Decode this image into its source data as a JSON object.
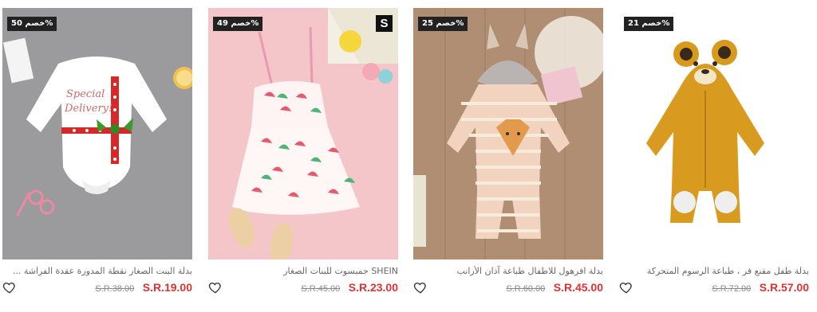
{
  "colors": {
    "sale": "#e03131",
    "badge_bg": "#222222",
    "old_price": "#888888"
  },
  "products": [
    {
      "badge": "خصم 50%",
      "title": "بدلة البنت الصغار نقطة المدورة عقدة الفراشة ...",
      "old_price": "S.R.38.00",
      "price": "S.R.19.00",
      "icon": "heart-icon"
    },
    {
      "badge": "خصم 49%",
      "brand": "S",
      "title": "SHEIN جمبسوت للبنات الصغار",
      "old_price": "S.R.45.00",
      "price": "S.R.23.00",
      "icon": "heart-icon"
    },
    {
      "badge": "خصم 25%",
      "title": "بدلة افرهول للاطفال طباعة آذان الأرانب",
      "old_price": "S.R.60.00",
      "price": "S.R.45.00",
      "icon": "heart-icon"
    },
    {
      "badge": "خصم 21%",
      "title": "بدلة طفل مقنع فر ، طباعة الرسوم المتحركة",
      "old_price": "S.R.72.00",
      "price": "S.R.57.00",
      "icon": "heart-icon"
    }
  ]
}
